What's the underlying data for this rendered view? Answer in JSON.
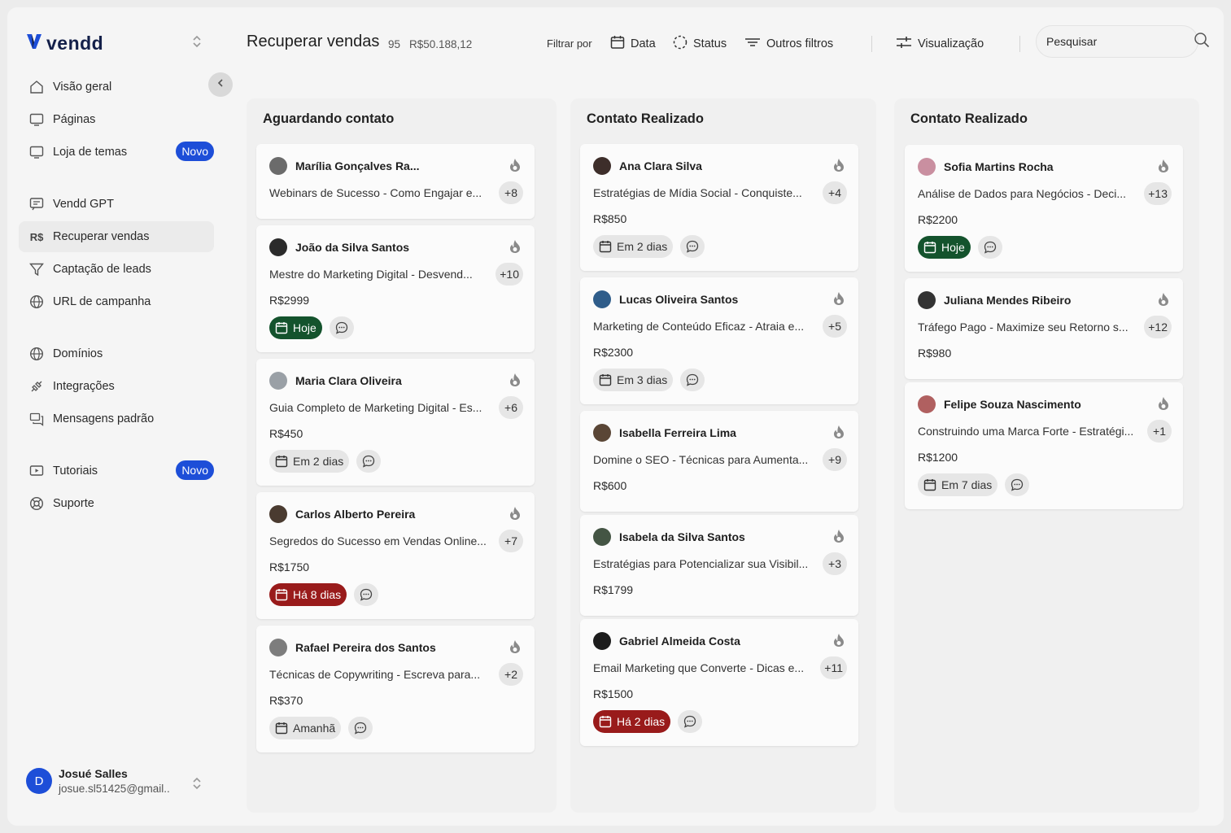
{
  "brand": {
    "name": "vendd"
  },
  "sidebar": {
    "items": [
      {
        "label": "Visão geral"
      },
      {
        "label": "Páginas"
      },
      {
        "label": "Loja de temas",
        "badge": "Novo"
      },
      {
        "label": "Vendd GPT"
      },
      {
        "label": "Recuperar vendas",
        "prefix": "R$"
      },
      {
        "label": "Captação de leads"
      },
      {
        "label": "URL de campanha"
      },
      {
        "label": "Domínios"
      },
      {
        "label": "Integrações"
      },
      {
        "label": "Mensagens padrão"
      },
      {
        "label": "Tutoriais",
        "badge": "Novo"
      },
      {
        "label": "Suporte"
      }
    ],
    "active": "Recuperar vendas"
  },
  "user": {
    "initial": "D",
    "name": "Josué Salles",
    "email": "josue.sl51425@gmail.."
  },
  "header": {
    "title": "Recuperar vendas",
    "count": "95",
    "total": "R$50.188,12",
    "filter_label": "Filtrar por",
    "filters": {
      "date": "Data",
      "status": "Status",
      "other": "Outros filtros"
    },
    "view": "Visualização",
    "search_placeholder": "Pesquisar"
  },
  "colors": {
    "accent": "#1d4ed8",
    "today": "#14532d",
    "overdue": "#991b1b"
  },
  "columns": [
    {
      "title": "Aguardando contato",
      "cards": [
        {
          "name": "Marília Gonçalves Ra...",
          "course": "Webinars de Sucesso - Como Engajar e...",
          "extra": "+8",
          "price": "",
          "tag": "",
          "tag_style": ""
        },
        {
          "name": "João da Silva Santos",
          "course": "Mestre do Marketing Digital - Desvend...",
          "extra": "+10",
          "price": "R$2999",
          "tag": "Hoje",
          "tag_style": "green"
        },
        {
          "name": "Maria Clara Oliveira",
          "course": "Guia Completo de Marketing Digital - Es...",
          "extra": "+6",
          "price": "R$450",
          "tag": "Em 2 dias",
          "tag_style": "gray"
        },
        {
          "name": "Carlos Alberto Pereira",
          "course": "Segredos do Sucesso em Vendas Online...",
          "extra": "+7",
          "price": "R$1750",
          "tag": "Há 8 dias",
          "tag_style": "red"
        },
        {
          "name": "Rafael Pereira dos Santos",
          "course": "Técnicas de Copywriting - Escreva para...",
          "extra": "+2",
          "price": "R$370",
          "tag": "Amanhã",
          "tag_style": "gray"
        }
      ]
    },
    {
      "title": "Contato Realizado",
      "cards": [
        {
          "name": "Ana Clara Silva",
          "course": "Estratégias de Mídia Social - Conquiste...",
          "extra": "+4",
          "price": "R$850",
          "tag": "Em 2 dias",
          "tag_style": "gray"
        },
        {
          "name": "Lucas Oliveira Santos",
          "course": "Marketing de Conteúdo Eficaz - Atraia e...",
          "extra": "+5",
          "price": "R$2300",
          "tag": "Em 3 dias",
          "tag_style": "gray"
        },
        {
          "name": "Isabella Ferreira Lima",
          "course": "Domine o SEO - Técnicas para Aumenta...",
          "extra": "+9",
          "price": "R$600",
          "tag": "",
          "tag_style": ""
        },
        {
          "name": "Isabela da Silva Santos",
          "course": "Estratégias para Potencializar sua Visibil...",
          "extra": "+3",
          "price": "R$1799",
          "tag": "",
          "tag_style": ""
        },
        {
          "name": "Gabriel Almeida Costa",
          "course": "Email Marketing que Converte - Dicas e...",
          "extra": "+11",
          "price": "R$1500",
          "tag": "Há 2 dias",
          "tag_style": "red"
        }
      ]
    },
    {
      "title": "Contato Realizado",
      "cards": [
        {
          "name": "Sofia Martins Rocha",
          "course": "Análise de Dados para Negócios - Deci...",
          "extra": "+13",
          "price": "R$2200",
          "tag": "Hoje",
          "tag_style": "green"
        },
        {
          "name": "Juliana Mendes Ribeiro",
          "course": "Tráfego Pago - Maximize seu Retorno s...",
          "extra": "+12",
          "price": "R$980",
          "tag": "",
          "tag_style": ""
        },
        {
          "name": "Felipe Souza Nascimento",
          "course": "Construindo uma Marca Forte - Estratégi...",
          "extra": "+1",
          "price": "R$1200",
          "tag": "Em 7 dias",
          "tag_style": "gray"
        }
      ]
    }
  ]
}
